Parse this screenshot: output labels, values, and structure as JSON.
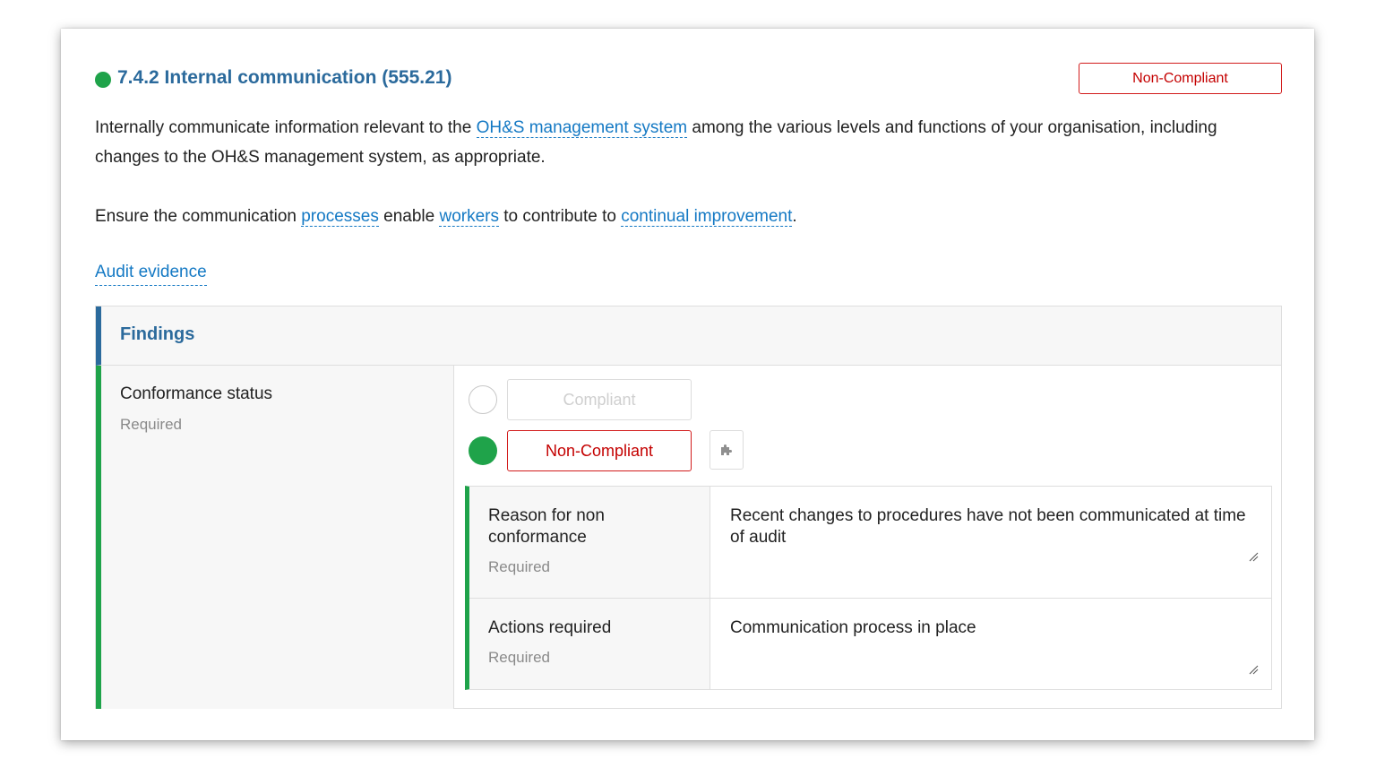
{
  "section": {
    "title": "7.4.2 Internal communication (555.21)",
    "status_badge": "Non-Compliant",
    "status_color": "#1fa34a"
  },
  "description": {
    "p1_part1": "Internally communicate information relevant to the ",
    "p1_term1": "OH&S management system",
    "p1_part2": " among the various levels and functions of your organisation, including changes to the OH&S management system, as appropriate.",
    "p2_part1": "Ensure the communication ",
    "p2_term1": "processes",
    "p2_part2": " enable ",
    "p2_term2": "workers",
    "p2_part3": " to contribute to ",
    "p2_term3": "continual improvement",
    "p2_part4": "."
  },
  "audit_evidence_link": "Audit evidence",
  "findings": {
    "title": "Findings",
    "conformance": {
      "label": "Conformance status",
      "required": "Required",
      "options": [
        {
          "label": "Compliant",
          "selected": false
        },
        {
          "label": "Non-Compliant",
          "selected": true
        }
      ],
      "addon_icon": "puzzle-icon"
    },
    "sub_fields": [
      {
        "label": "Reason for non conformance",
        "required": "Required",
        "value": "Recent changes to procedures have not been communicated at time of audit"
      },
      {
        "label": "Actions required",
        "required": "Required",
        "value": "Communication process in place"
      }
    ]
  },
  "colors": {
    "accent_blue": "#2b6a9c",
    "link_blue": "#1479c4",
    "success_green": "#1fa34a",
    "danger_red": "#d21c1c"
  }
}
